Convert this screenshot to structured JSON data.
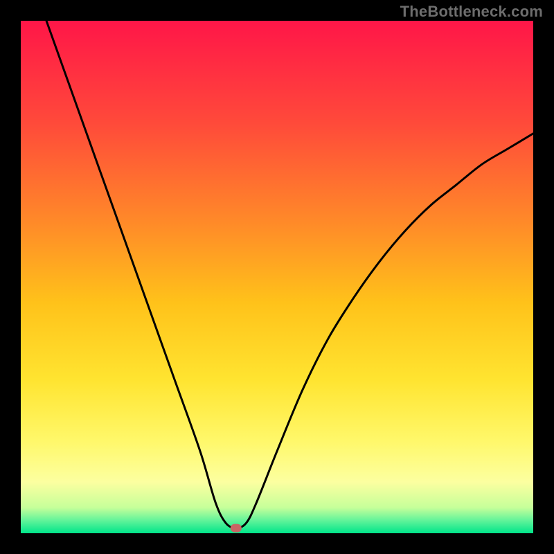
{
  "watermark": "TheBottleneck.com",
  "chart_data": {
    "type": "line",
    "title": "",
    "xlabel": "",
    "ylabel": "",
    "xlim": [
      0,
      100
    ],
    "ylim": [
      0,
      100
    ],
    "curve": {
      "minimum_x": 42,
      "series": [
        {
          "x": 5,
          "y": 100
        },
        {
          "x": 10,
          "y": 86
        },
        {
          "x": 15,
          "y": 72
        },
        {
          "x": 20,
          "y": 58
        },
        {
          "x": 25,
          "y": 44
        },
        {
          "x": 30,
          "y": 30
        },
        {
          "x": 35,
          "y": 16
        },
        {
          "x": 38,
          "y": 6
        },
        {
          "x": 40,
          "y": 2
        },
        {
          "x": 42,
          "y": 1
        },
        {
          "x": 44,
          "y": 2
        },
        {
          "x": 46,
          "y": 6
        },
        {
          "x": 50,
          "y": 16
        },
        {
          "x": 55,
          "y": 28
        },
        {
          "x": 60,
          "y": 38
        },
        {
          "x": 65,
          "y": 46
        },
        {
          "x": 70,
          "y": 53
        },
        {
          "x": 75,
          "y": 59
        },
        {
          "x": 80,
          "y": 64
        },
        {
          "x": 85,
          "y": 68
        },
        {
          "x": 90,
          "y": 72
        },
        {
          "x": 95,
          "y": 75
        },
        {
          "x": 100,
          "y": 78
        }
      ]
    },
    "marker": {
      "x": 42,
      "y": 1,
      "color": "#c86464"
    },
    "gradient_stops": [
      {
        "offset": 0.0,
        "color": "#ff1648"
      },
      {
        "offset": 0.2,
        "color": "#ff4a3a"
      },
      {
        "offset": 0.4,
        "color": "#ff8c28"
      },
      {
        "offset": 0.55,
        "color": "#ffc21a"
      },
      {
        "offset": 0.7,
        "color": "#ffe430"
      },
      {
        "offset": 0.82,
        "color": "#fff86a"
      },
      {
        "offset": 0.9,
        "color": "#fcffa0"
      },
      {
        "offset": 0.95,
        "color": "#c6ff9a"
      },
      {
        "offset": 0.975,
        "color": "#62f39a"
      },
      {
        "offset": 1.0,
        "color": "#00e58a"
      }
    ]
  }
}
